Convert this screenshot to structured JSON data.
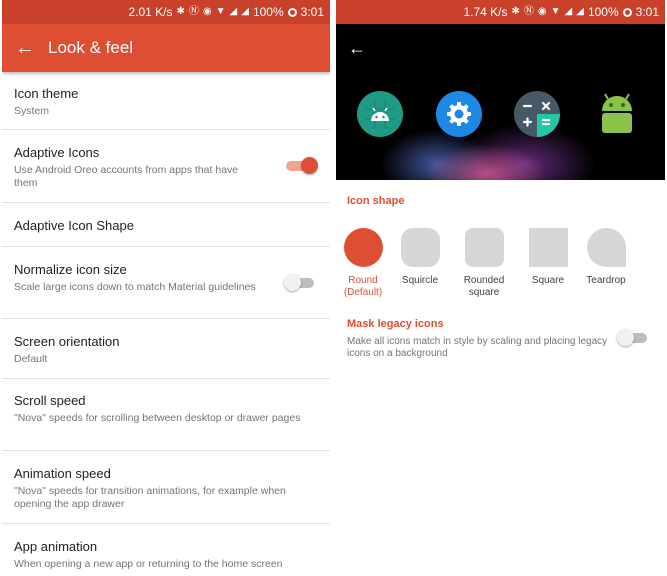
{
  "left": {
    "status": {
      "speed": "2.01 K/s",
      "battery": "100%",
      "time": "3:01"
    },
    "toolbar": {
      "title": "Look & feel"
    },
    "settings": [
      {
        "title": "Icon theme",
        "subtitle": "System"
      },
      {
        "title": "Adaptive Icons",
        "subtitle": "Use Android Oreo accounts from apps that have them",
        "toggle": true
      },
      {
        "title": "Adaptive Icon Shape",
        "subtitle": ""
      },
      {
        "title": "Normalize icon size",
        "subtitle": "Scale large icons down to match Material guidelines",
        "toggle": false
      },
      {
        "title": "Screen orientation",
        "subtitle": "Default"
      },
      {
        "title": "Scroll speed",
        "subtitle": "\"Nova\" speeds for scrolling between desktop or drawer pages"
      },
      {
        "title": "Animation speed",
        "subtitle": "\"Nova\" speeds for transition animations, for example when opening the app drawer"
      },
      {
        "title": "App animation",
        "subtitle": "When opening a new app or returning to the home screen"
      }
    ]
  },
  "right": {
    "status": {
      "speed": "1.74 K/s",
      "battery": "100%",
      "time": "3:01"
    },
    "preview_icons": [
      "android-app-icon",
      "settings-app-icon",
      "calculator-app-icon",
      "android-robot-icon"
    ],
    "icon_shape": {
      "header": "Icon shape",
      "options": [
        {
          "label": "Round\n(Default)",
          "selected": true
        },
        {
          "label": "Squircle",
          "selected": false
        },
        {
          "label": "Rounded\nsquare",
          "selected": false
        },
        {
          "label": "Square",
          "selected": false
        },
        {
          "label": "Teardrop",
          "selected": false
        }
      ]
    },
    "mask_legacy": {
      "title": "Mask legacy icons",
      "description": "Make all icons match in style by scaling and placing legacy icons on a background",
      "enabled": false
    }
  },
  "colors": {
    "accent": "#dd4e33",
    "status_bar": "#c9412a"
  }
}
